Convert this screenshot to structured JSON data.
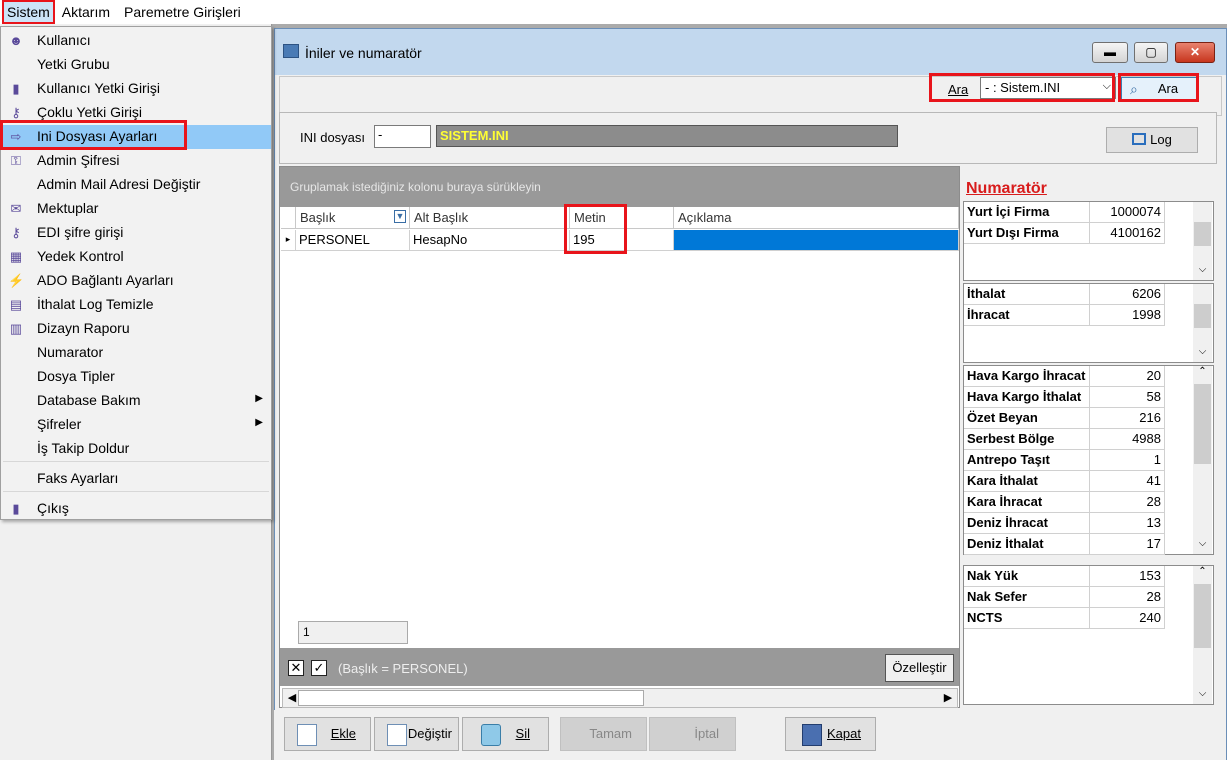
{
  "menubar": {
    "items": [
      "Sistem",
      "Aktarım",
      "Paremetre Girişleri"
    ]
  },
  "sistem_menu": {
    "items": [
      {
        "label": "Kullanıcı",
        "icon": "user-icon"
      },
      {
        "label": "Yetki Grubu",
        "icon": ""
      },
      {
        "label": "Kullanıcı Yetki Girişi",
        "icon": "user-key-icon"
      },
      {
        "label": "Çoklu Yetki Girişi",
        "icon": "keys-icon"
      },
      {
        "label": "Ini Dosyası  Ayarları",
        "icon": "settings-file-icon"
      },
      {
        "label": "Admin Şifresi",
        "icon": "key-icon"
      },
      {
        "label": "Admin Mail Adresi Değiştir",
        "icon": ""
      },
      {
        "label": "Mektuplar",
        "icon": "letter-icon"
      },
      {
        "label": "EDI şifre girişi",
        "icon": "edi-key-icon"
      },
      {
        "label": "Yedek Kontrol",
        "icon": "backup-icon"
      },
      {
        "label": "ADO Bağlantı Ayarları",
        "icon": "connection-icon"
      },
      {
        "label": "İthalat Log Temizle",
        "icon": "clean-icon"
      },
      {
        "label": "Dizayn Raporu",
        "icon": "report-icon"
      },
      {
        "label": "Numarator",
        "icon": ""
      },
      {
        "label": "Dosya Tipler",
        "icon": ""
      },
      {
        "label": "Database Bakım",
        "icon": ""
      },
      {
        "label": "Şifreler",
        "icon": ""
      },
      {
        "label": "İş Takip Doldur",
        "icon": ""
      },
      {
        "label": "Faks Ayarları",
        "icon": ""
      },
      {
        "label": "Çıkış",
        "icon": "exit-icon"
      }
    ]
  },
  "window": {
    "title": "İniler ve numaratör",
    "minimize": "▬",
    "maximize": "▢",
    "close": "✕"
  },
  "search": {
    "label": "Ara",
    "combo_value": "- : Sistem.INI",
    "button": "Ara"
  },
  "ini": {
    "label": "INI dosyası",
    "prefix": "-",
    "file": "SISTEM.INI",
    "log_button": "Log"
  },
  "grid": {
    "group_hint": "Gruplamak istediğiniz kolonu buraya sürükleyin",
    "columns": [
      "Başlık",
      "Alt Başlık",
      "Metin",
      "Açıklama"
    ],
    "rows": [
      {
        "baslik": "PERSONEL",
        "alt_baslik": "HesapNo",
        "metin": "195",
        "aciklama": ""
      }
    ],
    "count": "1",
    "filter_text": "(Başlık = PERSONEL)",
    "customize_button": "Özelleştir"
  },
  "numarator": {
    "title": "Numaratör",
    "group1": [
      {
        "k": "Yurt İçi Firma",
        "v": "1000074"
      },
      {
        "k": "Yurt Dışı Firma",
        "v": "4100162"
      }
    ],
    "group2": [
      {
        "k": "İthalat",
        "v": "6206"
      },
      {
        "k": "İhracat",
        "v": "1998"
      }
    ],
    "group3": [
      {
        "k": "Hava Kargo İhracat",
        "v": "20"
      },
      {
        "k": "Hava Kargo İthalat",
        "v": "58"
      },
      {
        "k": "Özet Beyan",
        "v": "216"
      },
      {
        "k": "Serbest Bölge",
        "v": "4988"
      },
      {
        "k": "Antrepo Taşıt",
        "v": "1"
      },
      {
        "k": "Kara İthalat",
        "v": "41"
      },
      {
        "k": "Kara İhracat",
        "v": "28"
      },
      {
        "k": "Deniz İhracat",
        "v": "13"
      },
      {
        "k": "Deniz İthalat",
        "v": "17"
      }
    ],
    "group4": [
      {
        "k": "Nak Yük",
        "v": "153"
      },
      {
        "k": "Nak Sefer",
        "v": "28"
      },
      {
        "k": "NCTS",
        "v": "240"
      }
    ]
  },
  "buttons": {
    "ekle": "Ekle",
    "degistir": "Değiştir",
    "sil": "Sil",
    "tamam": "Tamam",
    "iptal": "İptal",
    "kapat": "Kapat"
  },
  "colors": {
    "highlight": "#e8141b",
    "selection": "#0078d7",
    "numarator_title": "#d81c1c"
  }
}
